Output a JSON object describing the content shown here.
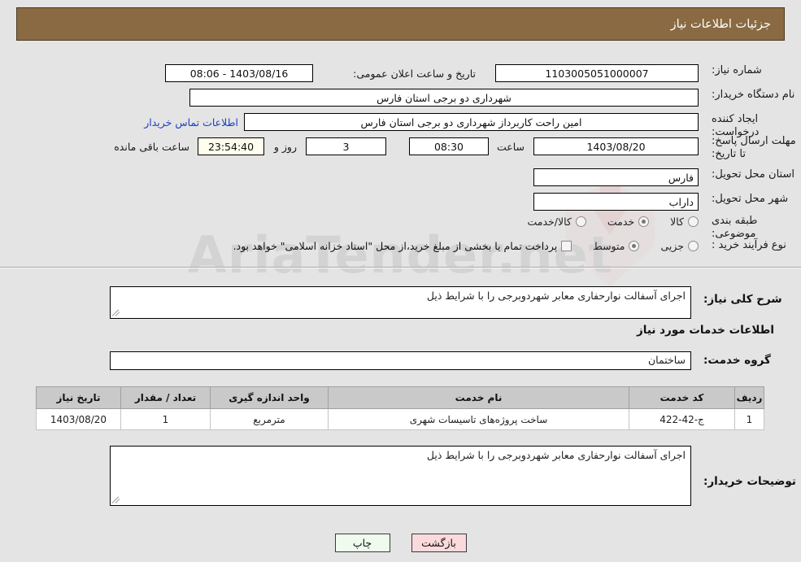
{
  "header": {
    "title": "جزئیات اطلاعات نیاز"
  },
  "watermark": {
    "text": "AriaTender.net"
  },
  "top_form": {
    "need_number_label": "شماره نیاز:",
    "need_number_value": "1103005051000007",
    "announce_label": "تاریخ و ساعت اعلان عمومی:",
    "announce_value": "1403/08/16 - 08:06",
    "buyer_org_label": "نام دستگاه خریدار:",
    "buyer_org_value": "شهرداری دو برجی استان فارس",
    "requester_label": "ایجاد کننده درخواست:",
    "requester_value": "امین راحت کاربرداز شهرداری دو برجی استان فارس",
    "contact_link": "اطلاعات تماس خریدار",
    "deadline_label": "مهلت ارسال پاسخ: تا تاریخ:",
    "deadline_date": "1403/08/20",
    "deadline_hour_label": "ساعت",
    "deadline_hour": "08:30",
    "days_remaining": "3",
    "days_label": "روز و",
    "countdown": "23:54:40",
    "countdown_label": "ساعت باقی مانده",
    "province_label": "استان محل تحویل:",
    "province_value": "فارس",
    "city_label": "شهر محل تحویل:",
    "city_value": "داراب",
    "category_label": "طبقه بندی موضوعی:",
    "category_options": [
      {
        "label": "کالا",
        "selected": false
      },
      {
        "label": "خدمت",
        "selected": true
      },
      {
        "label": "کالا/خدمت",
        "selected": false
      }
    ],
    "process_label": "نوع فرآیند خرید :",
    "process_options": [
      {
        "label": "جزیی",
        "selected": false
      },
      {
        "label": "متوسط",
        "selected": true
      }
    ],
    "treasury_checkbox_checked": false,
    "treasury_note": "پرداخت تمام یا بخشی از مبلغ خرید،از محل \"اسناد خزانه اسلامی\" خواهد بود."
  },
  "middle": {
    "general_desc_label": "شرح کلی نیاز:",
    "general_desc_value": "اجرای آسفالت نوارحفاری معابر شهردوبرجی را با شرایط ذیل",
    "services_heading": "اطلاعات خدمات مورد نیاز",
    "service_group_label": "گروه خدمت:",
    "service_group_value": "ساختمان",
    "buyer_notes_label": "توضیحات خریدار:",
    "buyer_notes_value": "اجرای آسفالت نوارحفاری معابر شهردوبرجی را با شرایط ذیل"
  },
  "table": {
    "columns": [
      "ردیف",
      "کد خدمت",
      "نام خدمت",
      "واحد اندازه گیری",
      "تعداد / مقدار",
      "تاریخ نیاز"
    ],
    "rows": [
      {
        "row_no": "1",
        "service_code": "ج-42-422",
        "service_name": "ساخت پروژه‌های تاسیسات شهری",
        "unit": "مترمربع",
        "quantity": "1",
        "need_date": "1403/08/20"
      }
    ]
  },
  "buttons": {
    "print": "چاپ",
    "back": "بازگشت"
  },
  "colors": {
    "header_bar": "#8a6a42",
    "page_bg": "#e4e4e4",
    "link": "#1a3fc4",
    "print_btn": "#eefbee",
    "back_btn": "#fadadd",
    "countdown_bg": "#fffdee"
  }
}
